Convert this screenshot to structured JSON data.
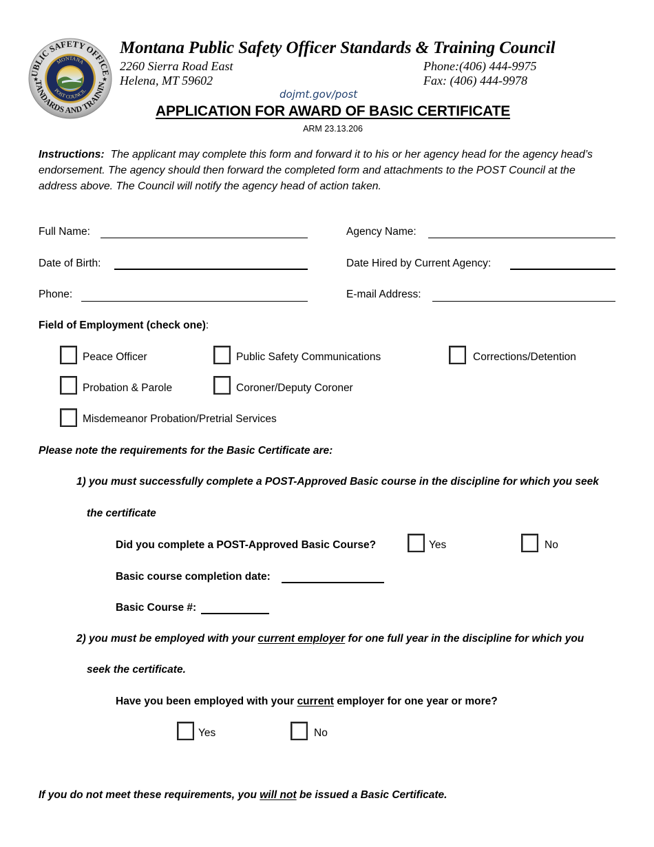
{
  "header": {
    "logo": {
      "outer_text_top": "PUBLIC SAFETY OFFICER",
      "outer_text_bottom": "STANDARDS AND TRAINING",
      "inner_text_top": "MONTANA",
      "inner_text_bottom": "POST COUNCIL"
    },
    "org_name": "Montana Public Safety Officer Standards & Training Council",
    "address_line1": "2260 Sierra Road East",
    "address_line2": "Helena, MT 59602",
    "phone": "Phone:(406) 444-9975",
    "fax": "Fax: (406) 444-9978",
    "website": "dojmt.gov/post",
    "colors": {
      "website": "#1f3f6e",
      "seal_blue": "#1b2a5c",
      "seal_gold": "#c9a23a"
    }
  },
  "document": {
    "title": "APPLICATION FOR AWARD OF BASIC CERTIFICATE",
    "rule_ref": "ARM 23.13.206"
  },
  "instructions": {
    "label": "Instructions:",
    "text": "The applicant may complete this form and forward it to his or her agency head for the agency head’s endorsement.  The agency should then forward the completed form and attachments to the POST Council at the address above.  The Council will notify the agency head of action taken."
  },
  "fields": {
    "full_name": {
      "label": "Full Name:",
      "value": ""
    },
    "agency_name": {
      "label": "Agency Name:",
      "value": ""
    },
    "dob": {
      "label": "Date of Birth:",
      "value": ""
    },
    "date_hired": {
      "label": "Date Hired by Current Agency:",
      "value": ""
    },
    "phone": {
      "label": "Phone:",
      "value": ""
    },
    "email": {
      "label": "E-mail Address:",
      "value": ""
    }
  },
  "employment": {
    "heading": "Field of Employment (check one)",
    "heading_suffix": ":",
    "options": [
      {
        "label": "Peace Officer",
        "checked": false
      },
      {
        "label": "Public Safety Communications",
        "checked": false
      },
      {
        "label": "Corrections/Detention",
        "checked": false
      },
      {
        "label": "Probation & Parole",
        "checked": false
      },
      {
        "label": "Coroner/Deputy Coroner",
        "checked": false
      },
      {
        "label": "Misdemeanor Probation/Pretrial Services",
        "checked": false
      }
    ]
  },
  "requirements": {
    "heading": "Please note the requirements for the Basic Certificate are:",
    "req1_line1": "1) you must successfully complete a POST-Approved Basic course in the discipline for which you seek",
    "req1_line2": "the certificate",
    "q1": {
      "label": "Did you complete a POST-Approved Basic Course?",
      "yes": "Yes",
      "no": "No",
      "yes_checked": false,
      "no_checked": false
    },
    "completion_date": {
      "label": "Basic course completion date:",
      "value": ""
    },
    "course_number": {
      "label": "Basic Course #:",
      "value": ""
    },
    "req2_pre": "2) you must be employed with your ",
    "req2_underlined": "current employer",
    "req2_post": " for one full year in the discipline for which you",
    "req2_line2": "seek the certificate.",
    "q2": {
      "pre": "Have you been employed with your ",
      "underlined": "current",
      "post": " employer for one year or more?",
      "yes": "Yes",
      "no": "No",
      "yes_checked": false,
      "no_checked": false
    }
  },
  "footer": {
    "pre": "If you do not meet these requirements, you ",
    "underlined": "will not",
    "post": " be issued a Basic Certificate."
  }
}
